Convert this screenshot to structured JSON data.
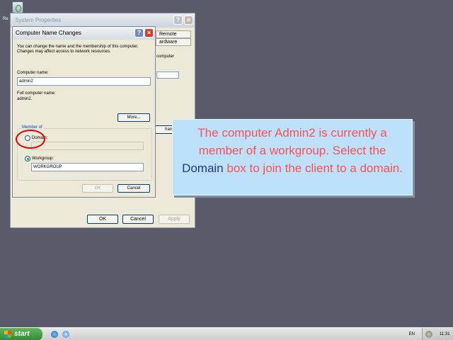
{
  "desktop": {
    "icon_label": "Re"
  },
  "system_properties": {
    "title": "System Properties",
    "tabs": [
      "Remote",
      "ardware"
    ],
    "partial_texts": [
      "computer",
      "hange..."
    ],
    "buttons": {
      "ok": "OK",
      "cancel": "Cancel",
      "apply": "Apply"
    }
  },
  "dialog": {
    "title": "Computer Name Changes",
    "description": "You can change the name and the membership of this computer. Changes may affect access to network resources.",
    "computer_name_label": "Computer name:",
    "computer_name_value": "admin2",
    "full_name_label": "Full computer name:",
    "full_name_value": "admin2.",
    "more_button": "More...",
    "member_of_label": "Member of",
    "domain_label": "Domain:",
    "domain_value": "",
    "workgroup_label": "Workgroup:",
    "workgroup_value": "WORKGROUP",
    "ok_button": "OK",
    "cancel_button": "Cancel"
  },
  "callout": {
    "text_before": "The computer Admin2 is currently a member of a workgroup. Select the ",
    "highlight": "Domain",
    "text_after": " box to join the client to a domain."
  },
  "taskbar": {
    "start_label": "start",
    "language": "EN",
    "clock": "11:31"
  },
  "colors": {
    "callout_text": "#ff5050",
    "callout_highlight": "#1a3a9a",
    "callout_background": "#bde0fb",
    "highlight_ring": "#e00000",
    "desktop": "#5a5a6a"
  }
}
